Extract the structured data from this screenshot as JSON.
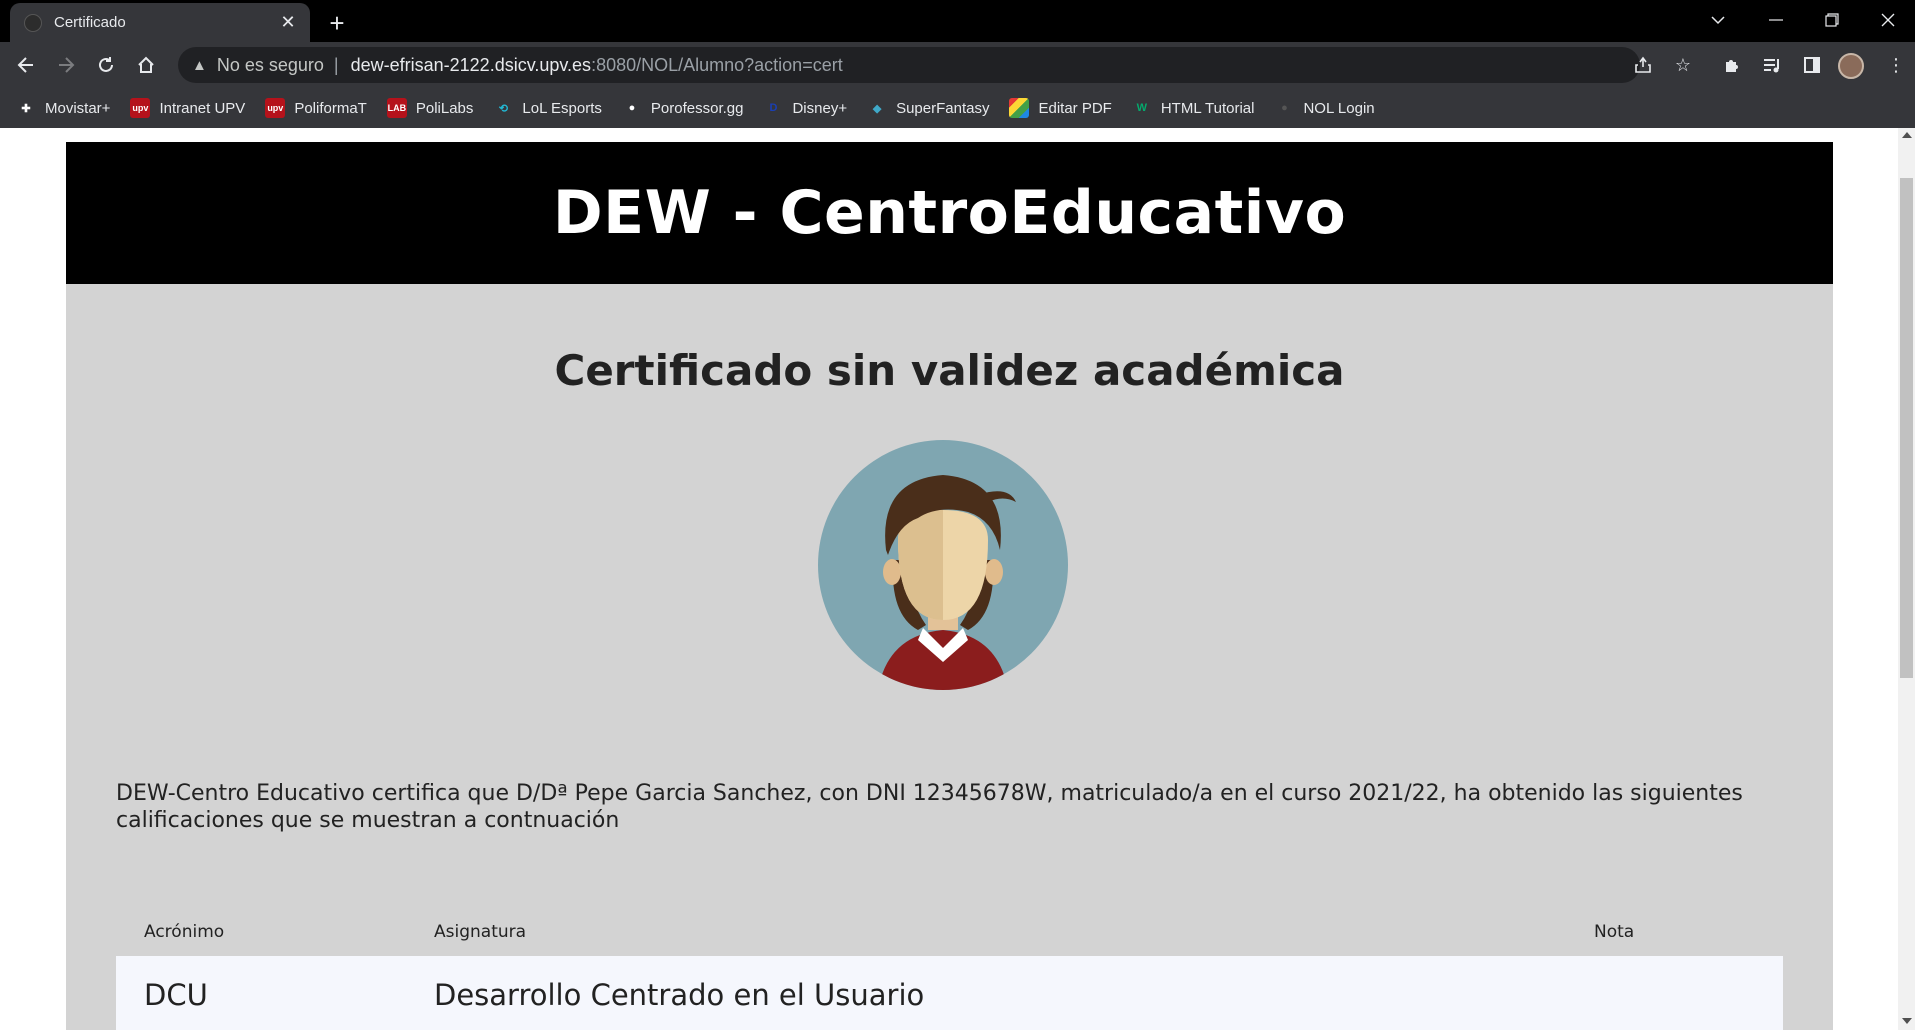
{
  "browser": {
    "tab_title": "Certificado",
    "tab_close": "✕",
    "new_tab": "+",
    "security_label": "No es seguro",
    "url_host": "dew-efrisan-2122.dsicv.upv.es",
    "url_path": ":8080/NOL/Alumno?action=cert",
    "bookmarks": [
      {
        "label": "Movistar+",
        "icon": "plus-icon",
        "color": "#ffffff"
      },
      {
        "label": "Intranet UPV",
        "icon": "upv-icon",
        "color": "#b5121b"
      },
      {
        "label": "PoliformaT",
        "icon": "upv-icon",
        "color": "#b5121b"
      },
      {
        "label": "PoliLabs",
        "icon": "lab-icon",
        "color": "#b5121b"
      },
      {
        "label": "LoL Esports",
        "icon": "lol-icon",
        "color": "#22b8d4"
      },
      {
        "label": "Porofessor.gg",
        "icon": "poro-icon",
        "color": "#ffffff"
      },
      {
        "label": "Disney+",
        "icon": "disney-icon",
        "color": "#1a3fb5"
      },
      {
        "label": "SuperFantasy",
        "icon": "drop-icon",
        "color": "#3fa9c9"
      },
      {
        "label": "Editar PDF",
        "icon": "pdf-icon",
        "color": "#e53935"
      },
      {
        "label": "HTML Tutorial",
        "icon": "w3-icon",
        "color": "#04aa6d"
      },
      {
        "label": "NOL Login",
        "icon": "globe-icon",
        "color": "#555555"
      }
    ],
    "bookmark_glyphs": {
      "plus-icon": "✚",
      "upv-icon": "upv",
      "lab-icon": "LAB",
      "lol-icon": "⟲",
      "poro-icon": "●",
      "disney-icon": "D",
      "drop-icon": "◆",
      "pdf-icon": "■",
      "w3-icon": "W",
      "globe-icon": "●"
    }
  },
  "page": {
    "site_title": "DEW - CentroEducativo",
    "certificate_title": "Certificado sin validez académica",
    "certificate_text": "DEW-Centro Educativo certifica que D/Dª Pepe Garcia Sanchez, con DNI 12345678W, matriculado/a en el curso 2021/22, ha obtenido las siguientes calificaciones que se muestran a contnuación",
    "table": {
      "headers": {
        "acronym": "Acrónimo",
        "subject": "Asignatura",
        "grade": "Nota"
      },
      "rows": [
        {
          "acronym": "DCU",
          "subject": "Desarrollo Centrado en el Usuario",
          "grade": ""
        }
      ]
    }
  },
  "colors": {
    "header_bg": "#000000",
    "page_bg": "#d3d3d3",
    "row_bg": "#f5f7fd",
    "avatar_bg": "#7fa6b1"
  }
}
